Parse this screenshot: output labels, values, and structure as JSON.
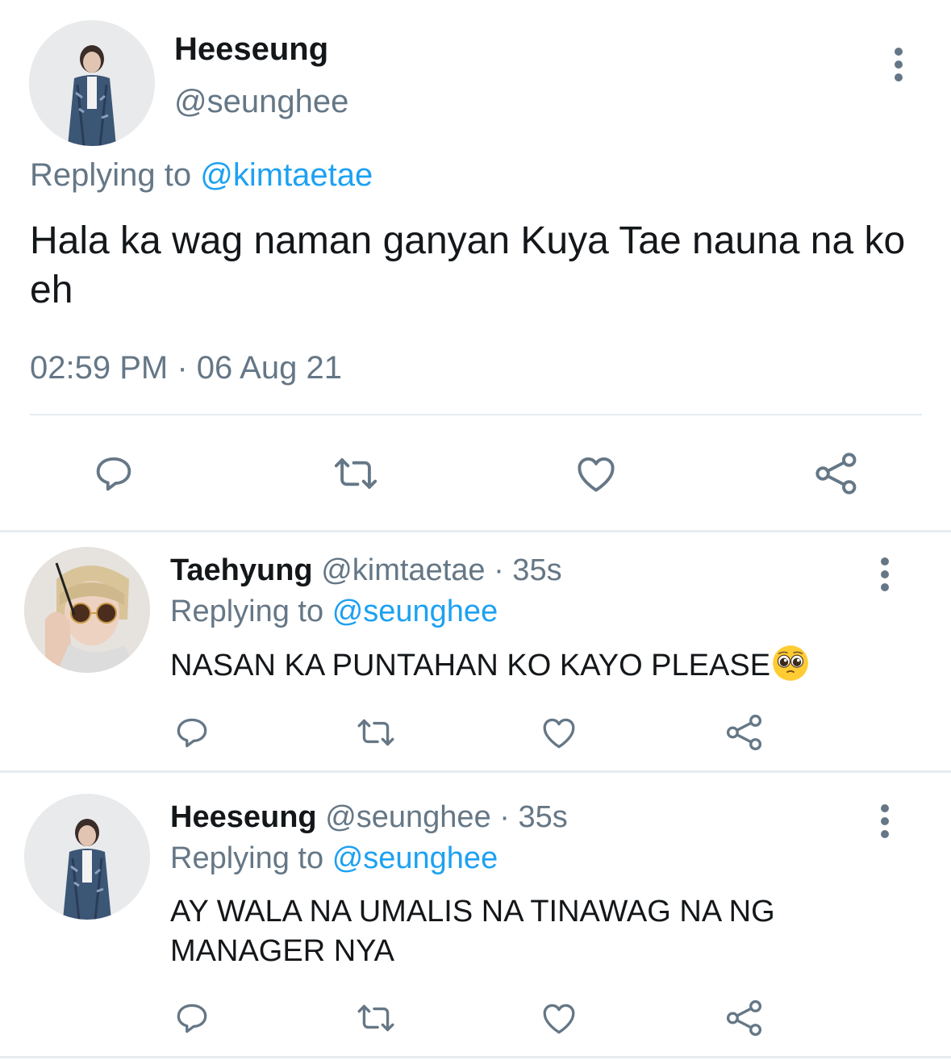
{
  "main_tweet": {
    "author_name": "Heeseung",
    "author_handle": "@seunghee",
    "replying_prefix": "Replying to",
    "replying_handle": "@kimtaetae",
    "text": "Hala ka wag naman ganyan Kuya Tae nauna na ko eh",
    "timestamp": "02:59 PM · 06 Aug 21",
    "menu_icon": "more-vertical-icon",
    "actions": [
      "reply-icon",
      "retweet-icon",
      "like-icon",
      "share-icon"
    ]
  },
  "replies": [
    {
      "author_name": "Taehyung",
      "author_handle": "@kimtaetae",
      "time_ago": "· 35s",
      "replying_prefix": "Replying to",
      "replying_handle": "@seunghee",
      "text": "NASAN KA PUNTAHAN KO KAYO PLEASE",
      "emoji": "pleading-face-emoji"
    },
    {
      "author_name": "Heeseung",
      "author_handle": "@seunghee",
      "time_ago": "· 35s",
      "replying_prefix": "Replying to",
      "replying_handle": "@seunghee",
      "text": "AY WALA NA UMALIS NA TINAWAG NA NG MANAGER NYA"
    }
  ],
  "colors": {
    "text": "#14171a",
    "secondary": "#657786",
    "link": "#1da1f2",
    "divider": "#e6ecf0",
    "icon": "#657786"
  }
}
